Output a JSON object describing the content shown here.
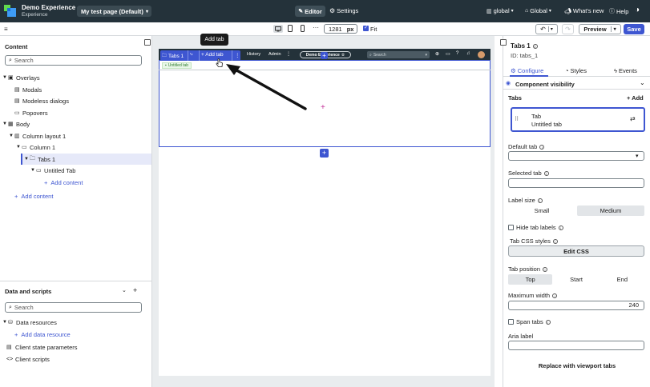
{
  "topbar": {
    "app_title": "Demo Experience",
    "app_subtitle": "Experience",
    "page_selector": "My test page (Default)",
    "editor_label": "Editor",
    "settings_label": "Settings",
    "global_label": "global",
    "global2_label": "Global",
    "whats_new_label": "What's new",
    "help_label": "Help"
  },
  "toolbar": {
    "width_value": "1281",
    "width_unit": "px",
    "fit_label": "Fit",
    "fit_checked": true,
    "preview_label": "Preview",
    "save_label": "Save"
  },
  "content_panel": {
    "title": "Content",
    "search_placeholder": "Search",
    "tree": {
      "overlays": "Overlays",
      "modals": "Modals",
      "modeless": "Modeless dialogs",
      "popovers": "Popovers",
      "body": "Body",
      "column_layout": "Column layout 1",
      "column": "Column 1",
      "tabs": "Tabs 1",
      "untitled_tab": "Untitled Tab",
      "add_content_inner": "Add content",
      "add_content": "Add content"
    }
  },
  "data_panel": {
    "title": "Data and scripts",
    "search_placeholder": "Search",
    "data_resources": "Data resources",
    "add_data_resource": "Add data resource",
    "client_state": "Client state parameters",
    "client_scripts": "Client scripts"
  },
  "canvas": {
    "tooltip": "Add tab",
    "component_label": "Tabs 1",
    "add_tab_label": "+ Add tab",
    "nav_history": "History",
    "nav_admin": "Admin",
    "nav_demo": "Demo Experience",
    "nav_search": "Search",
    "untitled_tab_label": "Untitled tab"
  },
  "properties": {
    "title": "Tabs 1",
    "id_label": "ID: tabs_1",
    "tab_configure": "Configure",
    "tab_styles": "Styles",
    "tab_events": "Events",
    "component_visibility": "Component visibility",
    "tabs_section": "Tabs",
    "add_label": "+ Add",
    "tab_item_title": "Tab",
    "tab_item_name": "Untitled tab",
    "default_tab_label": "Default tab",
    "selected_tab_label": "Selected tab",
    "label_size_label": "Label size",
    "size_small": "Small",
    "size_medium": "Medium",
    "size_selected": "Medium",
    "hide_tab_labels": "Hide tab labels",
    "hide_tab_labels_checked": false,
    "tab_css_styles": "Tab CSS styles",
    "edit_css": "Edit CSS",
    "tab_position_label": "Tab position",
    "pos_top": "Top",
    "pos_start": "Start",
    "pos_end": "End",
    "position_selected": "Top",
    "max_width_label": "Maximum width",
    "max_width_value": "240",
    "span_tabs": "Span tabs",
    "span_tabs_checked": false,
    "aria_label": "Aria label",
    "replace_viewport": "Replace with viewport tabs"
  },
  "colors": {
    "topbar_bg": "#24323a",
    "accent_blue": "#3e56d1",
    "canvas_bg": "#e9ecee",
    "selection_bg": "#e6e9f9",
    "save_bg": "#3e56d1",
    "add_marker": "#c4339a"
  }
}
